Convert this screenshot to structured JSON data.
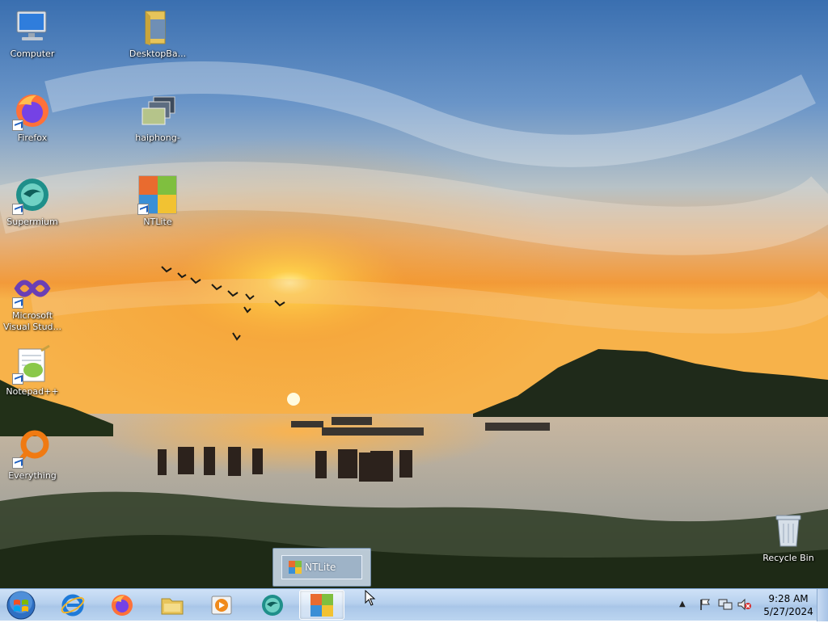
{
  "desktop": {
    "icons": [
      {
        "label": "Computer",
        "icon": "computer-icon"
      },
      {
        "label": "DesktopBa...",
        "icon": "folder-icon"
      },
      {
        "label": "Firefox",
        "icon": "firefox-icon"
      },
      {
        "label": "haiphong-",
        "icon": "image-file-icon"
      },
      {
        "label": "Supermium",
        "icon": "supermium-icon"
      },
      {
        "label": "NTLite",
        "icon": "ntlite-icon"
      },
      {
        "label": "Microsoft Visual Stud...",
        "icon": "visual-studio-icon"
      },
      {
        "label": "Notepad++",
        "icon": "notepadpp-icon"
      },
      {
        "label": "Everything",
        "icon": "everything-icon"
      },
      {
        "label": "Recycle Bin",
        "icon": "recycle-bin-icon"
      }
    ]
  },
  "taskbar": {
    "start": "windows-start-icon",
    "pinned": [
      {
        "name": "internet-explorer-icon",
        "active": false
      },
      {
        "name": "firefox-icon",
        "active": false
      },
      {
        "name": "explorer-folder-icon",
        "active": false
      },
      {
        "name": "media-player-icon",
        "active": false
      },
      {
        "name": "supermium-icon",
        "active": false
      },
      {
        "name": "ntlite-icon",
        "active": true
      }
    ],
    "preview": {
      "title": "NTLite"
    },
    "tray": {
      "icons": [
        "show-hidden-icons-chevron",
        "action-center-flag-icon",
        "network-icon",
        "volume-muted-icon"
      ],
      "time": "9:28 AM",
      "date": "5/27/2024"
    }
  },
  "colors": {
    "accent": "#2a6fc9",
    "taskbar": "#b6d0ee"
  }
}
